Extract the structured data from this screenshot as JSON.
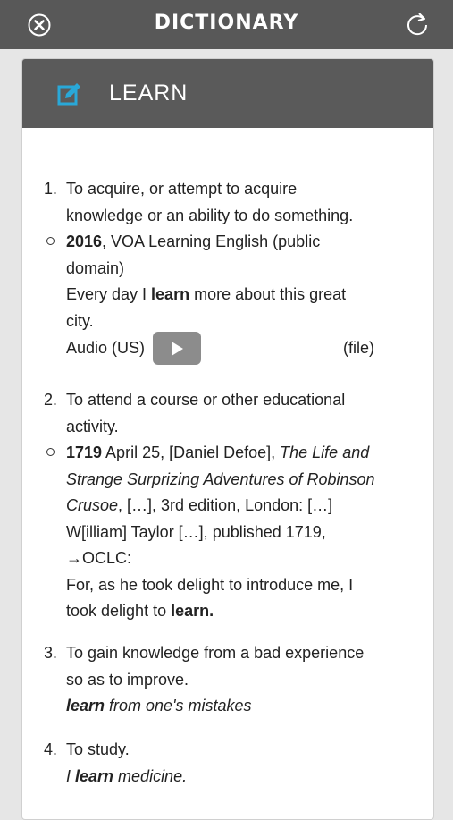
{
  "app": {
    "title": "DICTIONARY"
  },
  "header": {
    "word": "LEARN"
  },
  "senses": [
    {
      "number": "1.",
      "definition_line1": "To acquire, or attempt to acquire",
      "definition_line2": "knowledge or an ability to do something.",
      "quote_year": "2016",
      "quote_source_line1": ", VOA Learning English (public",
      "quote_source_line2": "domain)",
      "example_pre": "Every day I ",
      "example_bold": "learn",
      "example_post": " more about this great",
      "example_line2": "city.",
      "audio_label": "Audio (US)",
      "file_label": "(file)"
    },
    {
      "number": "2.",
      "definition_line1": "To attend a course or other educational",
      "definition_line2": "activity.",
      "quote_year": "1719",
      "quote_line1_rest": " April 25, [Daniel Defoe], ",
      "quote_title_1": "The Life and",
      "quote_title_2": "Strange Surprizing Adventures of Robinson",
      "quote_title_3": "Crusoe",
      "quote_line3_rest": ", […], 3rd edition, London: […]",
      "quote_line4": "W[illiam] Taylor […], published 1719,",
      "quote_line5": "→OCLC:",
      "example_line1": "For, as he took delight to introduce me, I",
      "example_line2_pre": "took delight to ",
      "example_line2_bold": "learn."
    },
    {
      "number": "3.",
      "definition_line1": "To gain knowledge from a bad experience",
      "definition_line2": "so as to improve.",
      "example_bold": "learn",
      "example_rest": " from one's mistakes"
    },
    {
      "number": "4.",
      "definition_line1": "To study.",
      "example_pre": "I ",
      "example_bold": "learn",
      "example_rest": " medicine."
    }
  ],
  "colors": {
    "topbar": "#585858",
    "card_header": "#5a5a5a",
    "accent_icon": "#29a8d8",
    "play_button": "#8c8c8c"
  },
  "icons": {
    "close": "close-circle-icon",
    "refresh": "refresh-icon",
    "edit": "edit-icon",
    "play": "play-icon"
  }
}
